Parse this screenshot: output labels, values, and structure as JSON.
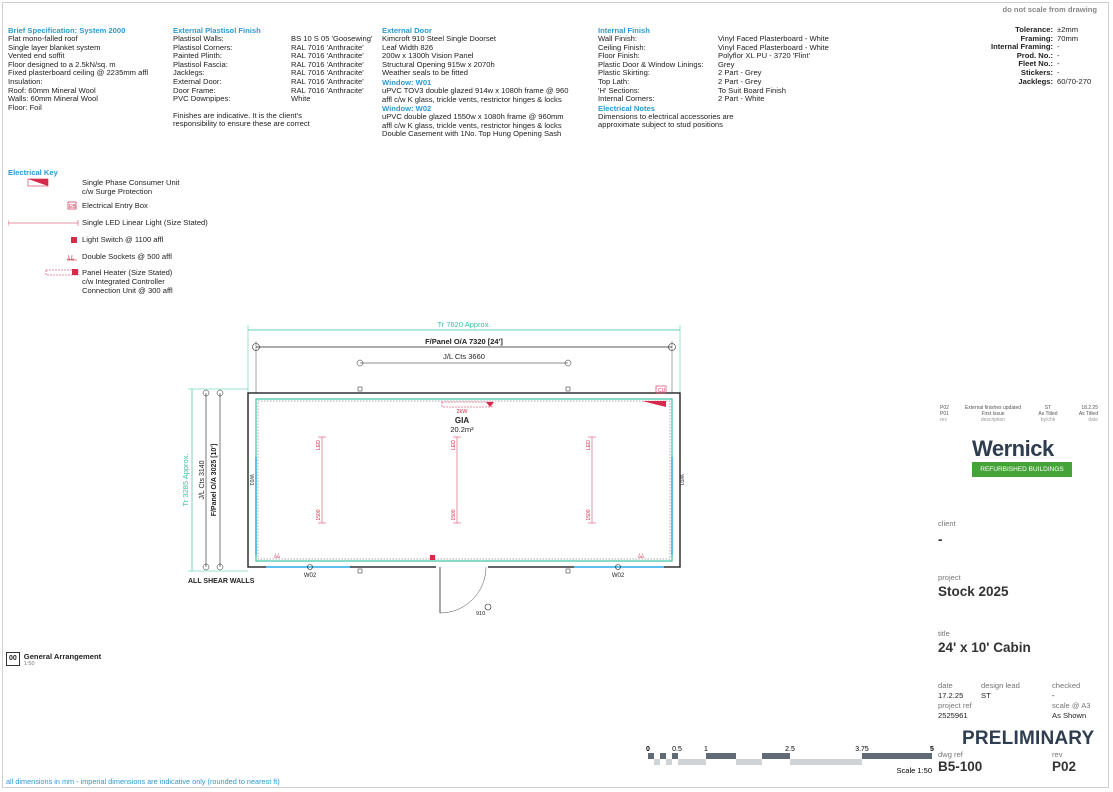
{
  "top_note": "do not scale from drawing",
  "brief": {
    "heading": "Brief Specification: System 2000",
    "lines": [
      "Flat mono-falled roof",
      "Single layer blanket system",
      "Vented end soffit",
      "Floor designed to a 2.5kN/sq. m",
      "Fixed plasterboard ceiling @ 2235mm affl",
      "Insulation:",
      "Roof: 60mm Mineral Wool",
      "Walls: 60mm Mineral Wool",
      "Floor: Foil"
    ]
  },
  "plastisol": {
    "heading": "External Plastisol Finish",
    "rows": [
      {
        "k": "Plastisol Walls:",
        "v": "BS 10 S 05 'Goosewing'"
      },
      {
        "k": "Plastisol Corners:",
        "v": "RAL 7016 'Anthracite'"
      },
      {
        "k": "Painted Plinth:",
        "v": "RAL 7016 'Anthracite'"
      },
      {
        "k": "Plastisol Fascia:",
        "v": "RAL 7016 'Anthracite'"
      },
      {
        "k": "Jacklegs:",
        "v": "RAL 7016 'Anthracite'"
      },
      {
        "k": "External Door:",
        "v": "RAL 7016 'Anthracite'"
      },
      {
        "k": "Door Frame:",
        "v": "RAL 7016 'Anthracite'"
      },
      {
        "k": "PVC Downpipes:",
        "v": "White"
      }
    ],
    "note1": "Finishes are indicative. It is the client's",
    "note2": "responsibility to ensure these are correct"
  },
  "door": {
    "heading": "External Door",
    "lines": [
      "Kimcroft 910 Steel Single Doorset",
      "Leaf Width 826",
      "200w x 1300h Vision Panel",
      "Structural Opening 915w x 2070h",
      "Weather seals to be fitted"
    ],
    "w01_heading": "Window: W01",
    "w01_lines": [
      "uPVC TOV3 double glazed 914w x 1080h frame @ 960",
      "affl c/w K glass, trickle vents, restrictor hinges & locks"
    ],
    "w02_heading": "Window: W02",
    "w02_lines": [
      "uPVC double glazed 1550w x 1080h frame @ 960mm",
      "affl c/w K glass, trickle vents, restrictor hinges & locks",
      "Double Casement with 1No. Top Hung Opening Sash"
    ]
  },
  "internal": {
    "heading": "Internal Finish",
    "rows": [
      {
        "k": "Wall Finish:",
        "v": "Vinyl Faced Plasterboard - White"
      },
      {
        "k": "Ceiling Finish:",
        "v": "Vinyl Faced Plasterboard - White"
      },
      {
        "k": "Floor Finish:",
        "v": "Polyflor XL PU - 3720 'Flint'"
      },
      {
        "k": "Plastic Door & Window Linings:",
        "v": "Grey"
      },
      {
        "k": "Plastic Skirting:",
        "v": "2 Part - Grey"
      },
      {
        "k": "Top Lath:",
        "v": "2 Part - Grey"
      },
      {
        "k": "'H' Sections:",
        "v": "To Suit Board Finish"
      },
      {
        "k": "Internal Corners:",
        "v": "2 Part - White"
      }
    ],
    "elec_heading": "Electrical Notes",
    "elec_lines": [
      "Dimensions to electrical accessories are",
      "approximate subject to stud positions"
    ]
  },
  "tolerances": [
    {
      "k": "Tolerance:",
      "v": "±2mm"
    },
    {
      "k": "Framing:",
      "v": "70mm"
    },
    {
      "k": "Internal Framing:",
      "v": "-"
    },
    {
      "k": "Prod. No.:",
      "v": "-"
    },
    {
      "k": "Fleet No.:",
      "v": "-"
    },
    {
      "k": "Stickers:",
      "v": "-"
    },
    {
      "k": "Jacklegs:",
      "v": "60/70-270"
    }
  ],
  "electrical_key": {
    "heading": "Electrical Key",
    "items": [
      {
        "l1": "Single Phase Consumer Unit",
        "l2": "c/w Surge Protection"
      },
      {
        "l1": "Electrical Entry Box"
      },
      {
        "l1": "Single LED Linear Light (Size Stated)"
      },
      {
        "l1": "Light Switch @ 1100 affl"
      },
      {
        "l1": "Double Sockets @ 500 affl"
      },
      {
        "l1": "Panel Heater (Size Stated)",
        "l2": "c/w Integrated Controller",
        "l3": "Connection Unit @ 300 affl"
      }
    ]
  },
  "plan": {
    "tr_width": "Tr 7620 Approx.",
    "fpanel_width": "F/Panel O/A 7320 [24']",
    "jl_cts": "J/L Cts 3660",
    "tr_depth": "Tr 3285 Approx.",
    "jl_cts_depth": "J/L Cts 3140",
    "fpanel_depth": "F/Panel O/A 3025 [10']",
    "gia_label": "GIA",
    "gia_value": "20.2m²",
    "heater": "2kW",
    "cu": "CU",
    "eb": "EB",
    "led": "LED",
    "led_len": "1500",
    "w01": "W01",
    "w02": "W02",
    "door_label": "910",
    "shear": "ALL SHEAR WALLS"
  },
  "view": {
    "num": "00",
    "title": "General Arrangement",
    "scale": "1:50"
  },
  "revision_table": {
    "rows": [
      {
        "rev": "P02",
        "desc": "External finishes updated",
        "by": "ST",
        "chk": "",
        "date": "18.2.25"
      },
      {
        "rev": "P01",
        "desc": "First Issue",
        "by": "As Titled",
        "chk": "",
        "date": "As Titled"
      }
    ],
    "headers": {
      "rev": "rev",
      "desc": "description",
      "by": "by/chk",
      "date": "date"
    }
  },
  "logo": {
    "name": "Wernick",
    "tagline": "REFURBISHED BUILDINGS",
    "green": "#46a33a"
  },
  "title_block": {
    "client_label": "client",
    "client": "-",
    "project_label": "project",
    "project": "Stock 2025",
    "title_label": "title",
    "title": "24' x 10' Cabin",
    "date_label": "date",
    "date": "17.2.25",
    "lead_label": "design lead",
    "lead": "ST",
    "checked_label": "checked",
    "checked": "-",
    "ref_label": "project ref",
    "ref": "2525961",
    "scale_label": "scale @ A3",
    "scale": "As Shown",
    "status": "PRELIMINARY",
    "dwg_label": "dwg ref",
    "dwg": "B5-100",
    "rev_label": "rev",
    "rev": "P02"
  },
  "scalebar": {
    "ticks": [
      "0",
      "0.5",
      "1",
      "2.5",
      "3.75",
      "5"
    ],
    "label": "Scale 1:50"
  },
  "footer": "all dimensions in mm - imperial dimensions are indicative only (rounded to nearest ft)",
  "colors": {
    "accent": "#2b9ad2",
    "teal": "#38c3a4",
    "red": "#d52a4b",
    "dark": "#2e3d4f"
  }
}
